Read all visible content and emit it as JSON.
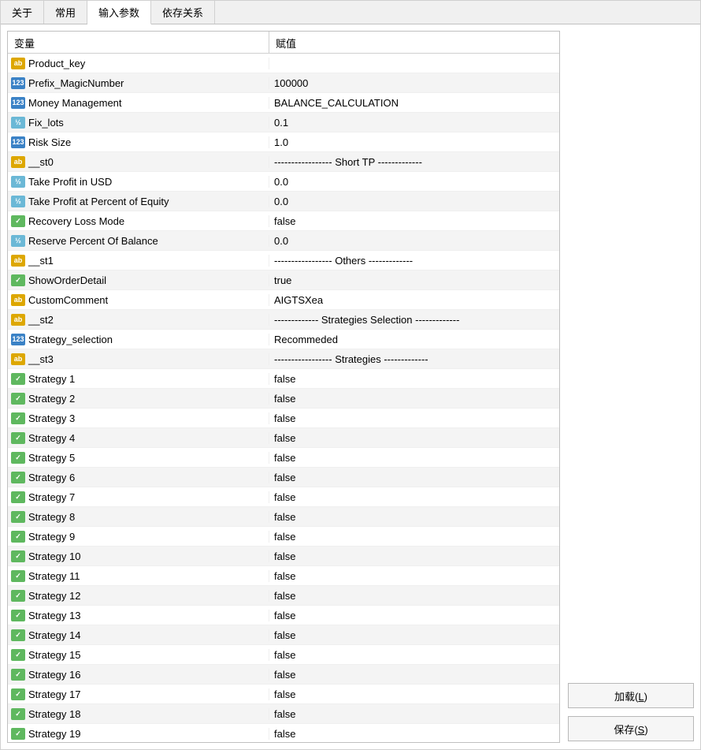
{
  "tabs": {
    "t0": "关于",
    "t1": "常用",
    "t2": "输入参数",
    "t3": "依存关系"
  },
  "headers": {
    "variable": "变量",
    "value": "赋值"
  },
  "rows": [
    {
      "type": "str",
      "name": "Product_key",
      "value": ""
    },
    {
      "type": "int",
      "name": "Prefix_MagicNumber",
      "value": "100000"
    },
    {
      "type": "int",
      "name": "Money Management",
      "value": "BALANCE_CALCULATION"
    },
    {
      "type": "dbl",
      "name": "Fix_lots",
      "value": "0.1"
    },
    {
      "type": "int",
      "name": "Risk Size",
      "value": "1.0"
    },
    {
      "type": "str",
      "name": "__st0",
      "value": "----------------- Short TP -------------"
    },
    {
      "type": "dbl",
      "name": "Take Profit in USD",
      "value": "0.0"
    },
    {
      "type": "dbl",
      "name": "Take Profit at Percent of Equity",
      "value": "0.0"
    },
    {
      "type": "bool",
      "name": "Recovery Loss Mode",
      "value": "false"
    },
    {
      "type": "dbl",
      "name": "Reserve Percent Of Balance",
      "value": "0.0"
    },
    {
      "type": "str",
      "name": "__st1",
      "value": "----------------- Others -------------"
    },
    {
      "type": "bool",
      "name": "ShowOrderDetail",
      "value": "true"
    },
    {
      "type": "str",
      "name": "CustomComment",
      "value": "AIGTSXea"
    },
    {
      "type": "str",
      "name": "__st2",
      "value": "------------- Strategies Selection -------------"
    },
    {
      "type": "int",
      "name": "Strategy_selection",
      "value": "Recommeded"
    },
    {
      "type": "str",
      "name": "__st3",
      "value": "----------------- Strategies -------------"
    },
    {
      "type": "bool",
      "name": "Strategy 1",
      "value": "false"
    },
    {
      "type": "bool",
      "name": "Strategy 2",
      "value": "false"
    },
    {
      "type": "bool",
      "name": "Strategy 3",
      "value": "false"
    },
    {
      "type": "bool",
      "name": "Strategy 4",
      "value": "false"
    },
    {
      "type": "bool",
      "name": "Strategy 5",
      "value": "false"
    },
    {
      "type": "bool",
      "name": "Strategy 6",
      "value": "false"
    },
    {
      "type": "bool",
      "name": "Strategy 7",
      "value": "false"
    },
    {
      "type": "bool",
      "name": "Strategy 8",
      "value": "false"
    },
    {
      "type": "bool",
      "name": "Strategy 9",
      "value": "false"
    },
    {
      "type": "bool",
      "name": "Strategy 10",
      "value": "false"
    },
    {
      "type": "bool",
      "name": "Strategy 11",
      "value": "false"
    },
    {
      "type": "bool",
      "name": "Strategy 12",
      "value": "false"
    },
    {
      "type": "bool",
      "name": "Strategy 13",
      "value": "false"
    },
    {
      "type": "bool",
      "name": "Strategy 14",
      "value": "false"
    },
    {
      "type": "bool",
      "name": "Strategy 15",
      "value": "false"
    },
    {
      "type": "bool",
      "name": "Strategy 16",
      "value": "false"
    },
    {
      "type": "bool",
      "name": "Strategy 17",
      "value": "false"
    },
    {
      "type": "bool",
      "name": "Strategy 18",
      "value": "false"
    },
    {
      "type": "bool",
      "name": "Strategy 19",
      "value": "false"
    }
  ],
  "buttons": {
    "load": "加载",
    "load_key": "L",
    "save": "保存",
    "save_key": "S"
  },
  "iconText": {
    "str": "ab",
    "int": "123",
    "dbl": "½",
    "bool": "✓"
  }
}
